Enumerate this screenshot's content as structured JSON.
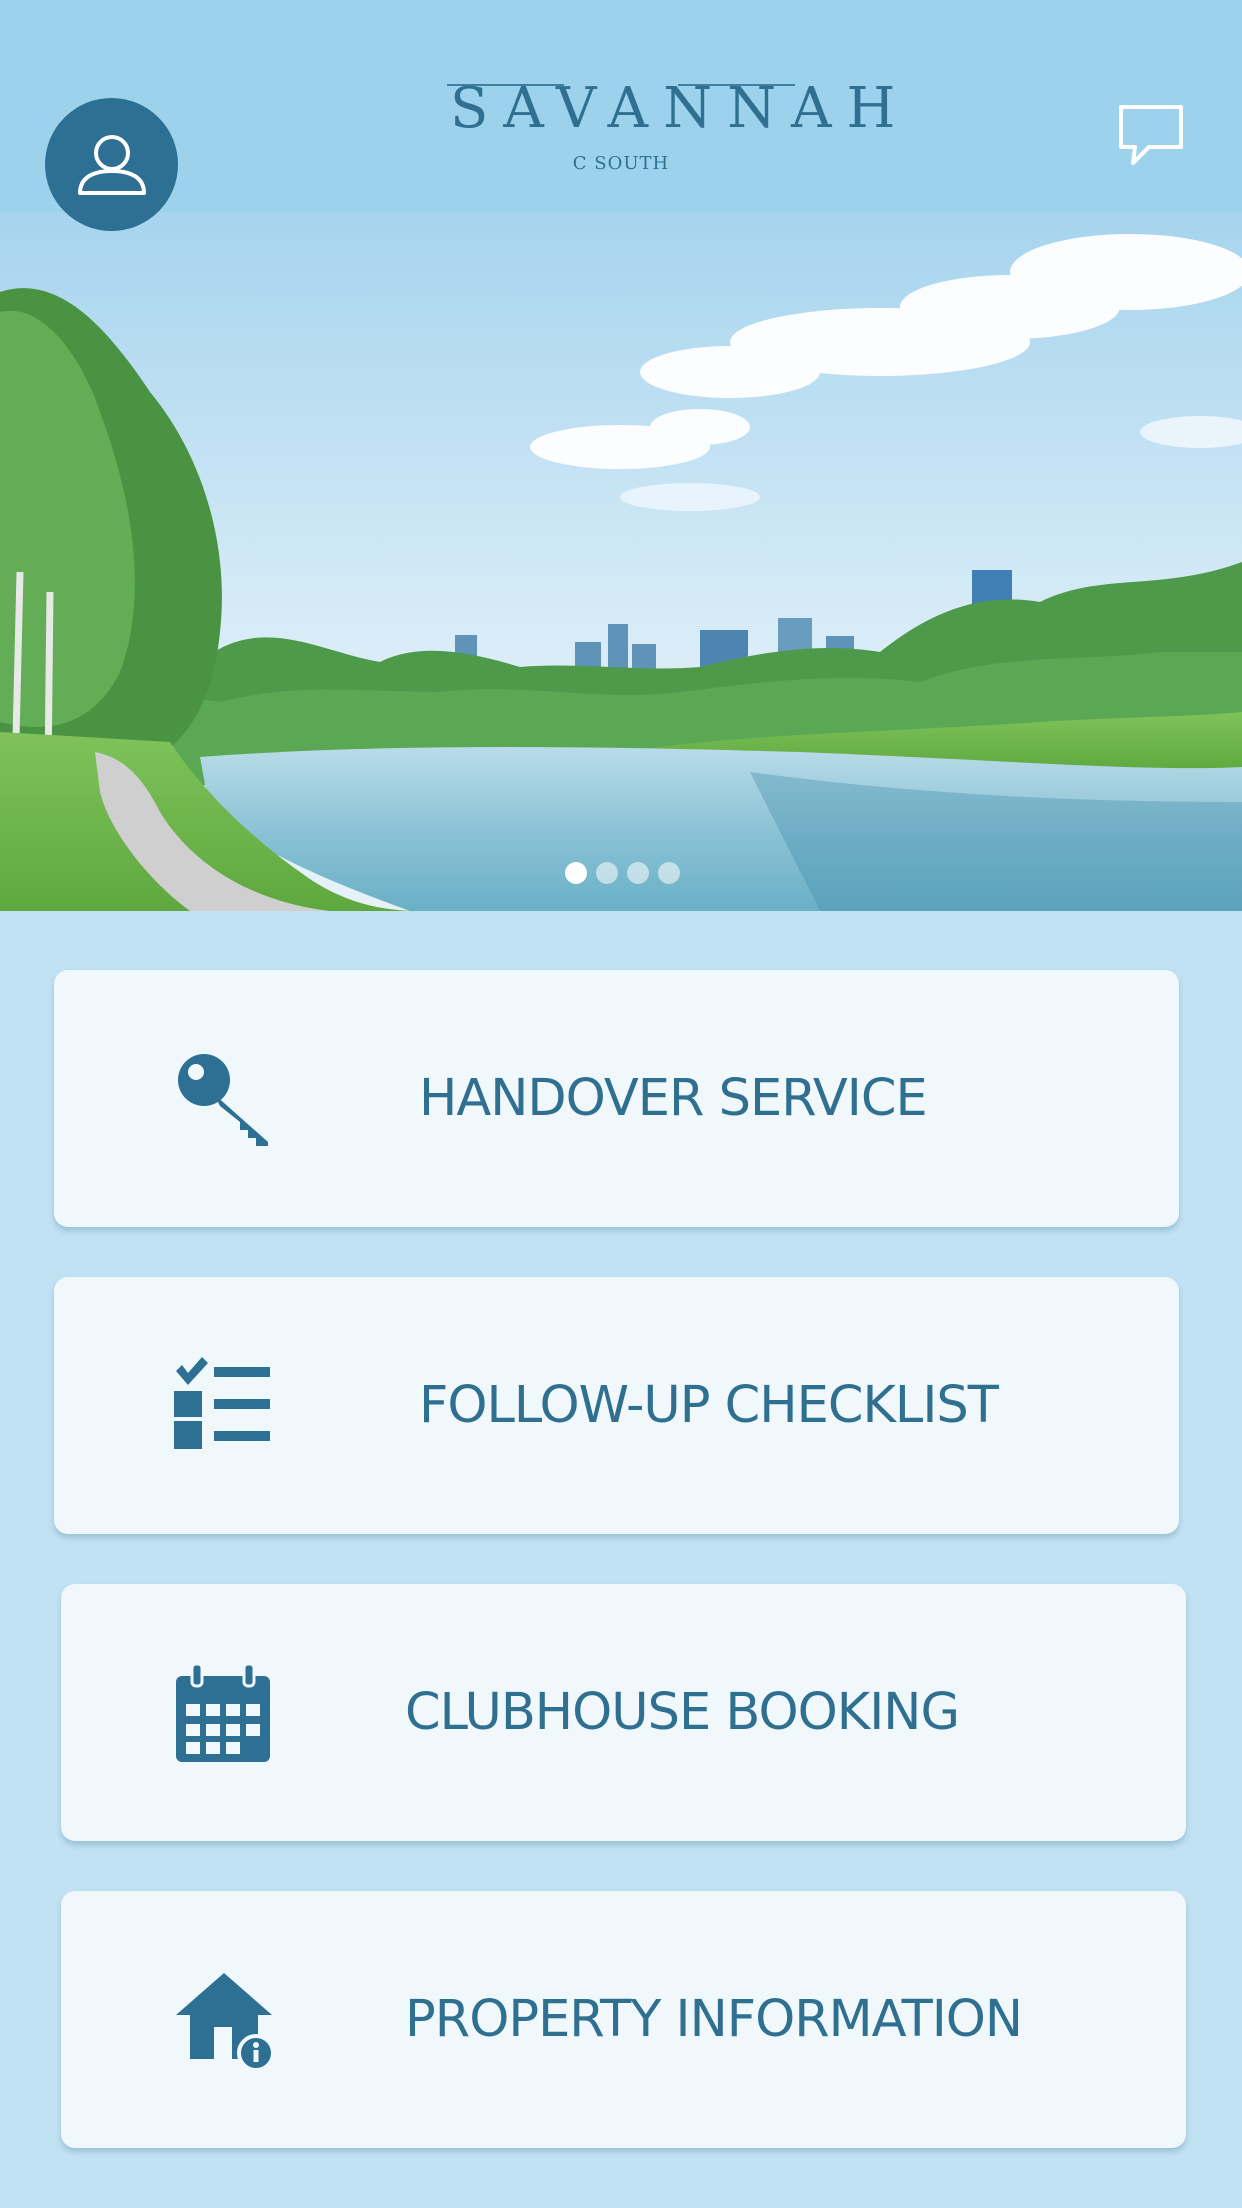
{
  "header": {
    "logo_title": "SAVANNAH",
    "logo_subtitle": "C SOUTH",
    "avatar_icon": "user-profile-icon",
    "chat_icon": "chat-bubble-icon"
  },
  "banner": {
    "slide_count": 4,
    "active_slide": 1
  },
  "menu": [
    {
      "label": "HANDOVER SERVICE",
      "icon": "key-icon"
    },
    {
      "label": "FOLLOW-UP CHECKLIST",
      "icon": "checklist-icon"
    },
    {
      "label": "CLUBHOUSE BOOKING",
      "icon": "calendar-icon"
    },
    {
      "label": "PROPERTY INFORMATION",
      "icon": "house-info-icon"
    }
  ],
  "colors": {
    "header_bg": "#9cd2ec",
    "page_bg": "#c1e2f3",
    "accent": "#2d7093",
    "card_bg": "#f1f8fc"
  }
}
